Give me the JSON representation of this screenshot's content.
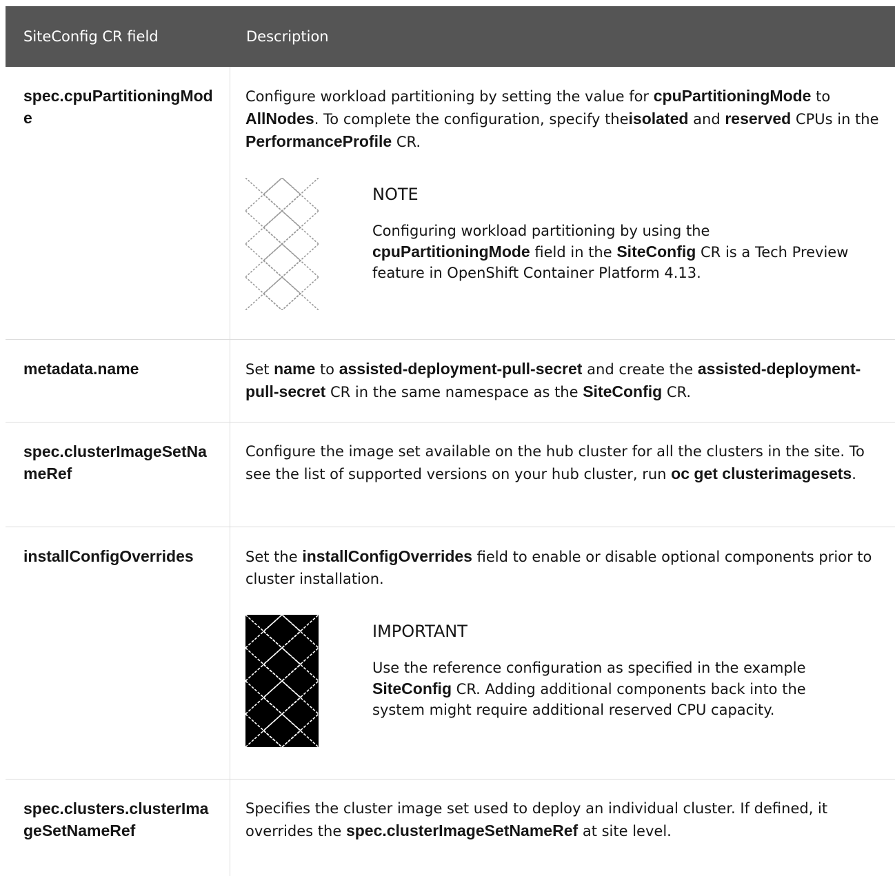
{
  "header": {
    "col1": "SiteConfig CR field",
    "col2": "Description"
  },
  "rows": [
    {
      "field": "spec.cpuPartitioningMode",
      "desc": [
        {
          "t": "Configure workload partitioning by setting the value for "
        },
        {
          "b": "cpuPartitioningMode"
        },
        {
          "t": " to "
        },
        {
          "b": "AllNodes"
        },
        {
          "t": ". To complete the configuration, specify the"
        },
        {
          "b": "isolated"
        },
        {
          "t": " and "
        },
        {
          "b": "reserved"
        },
        {
          "t": " CPUs in the "
        },
        {
          "b": "PerformanceProfile"
        },
        {
          "t": " CR."
        }
      ],
      "admonition": {
        "kind": "note",
        "icon": "note-icon",
        "title": "NOTE",
        "text": [
          {
            "t": "Configuring workload partitioning by using the "
          },
          {
            "b": "cpuPartitioningMode"
          },
          {
            "t": " field in the "
          },
          {
            "b": "SiteConfig"
          },
          {
            "t": " CR is a Tech Preview feature in OpenShift Container Platform 4.13."
          }
        ]
      }
    },
    {
      "field": "metadata.name",
      "desc": [
        {
          "t": "Set "
        },
        {
          "b": "name"
        },
        {
          "t": " to "
        },
        {
          "b": "assisted-deployment-pull-secret"
        },
        {
          "t": " and create the "
        },
        {
          "b": "assisted-deployment-pull-secret"
        },
        {
          "t": " CR in the same namespace as the "
        },
        {
          "b": "SiteConfig"
        },
        {
          "t": " CR."
        }
      ]
    },
    {
      "field": "spec.clusterImageSetNameRef",
      "desc": [
        {
          "t": "Configure the image set available on the hub cluster for all the clusters in the site. To see the list of supported versions on your hub cluster, run "
        },
        {
          "b": "oc get clusterimagesets"
        },
        {
          "t": "."
        }
      ]
    },
    {
      "field": "installConfigOverrides",
      "desc": [
        {
          "t": "Set the "
        },
        {
          "b": "installConfigOverrides"
        },
        {
          "t": " field to enable or disable optional components prior to cluster installation."
        }
      ],
      "admonition": {
        "kind": "important",
        "icon": "important-icon",
        "title": "IMPORTANT",
        "text": [
          {
            "t": "Use the reference configuration as specified in the example "
          },
          {
            "b": "SiteConfig"
          },
          {
            "t": " CR. Adding additional components back into the system might require additional reserved CPU capacity."
          }
        ]
      }
    },
    {
      "field": "spec.clusters.clusterImageSetNameRef",
      "desc": [
        {
          "t": "Specifies the cluster image set used to deploy an individual cluster. If defined, it overrides the "
        },
        {
          "b": "spec.clusterImageSetNameRef"
        },
        {
          "t": " at site level."
        }
      ]
    }
  ]
}
